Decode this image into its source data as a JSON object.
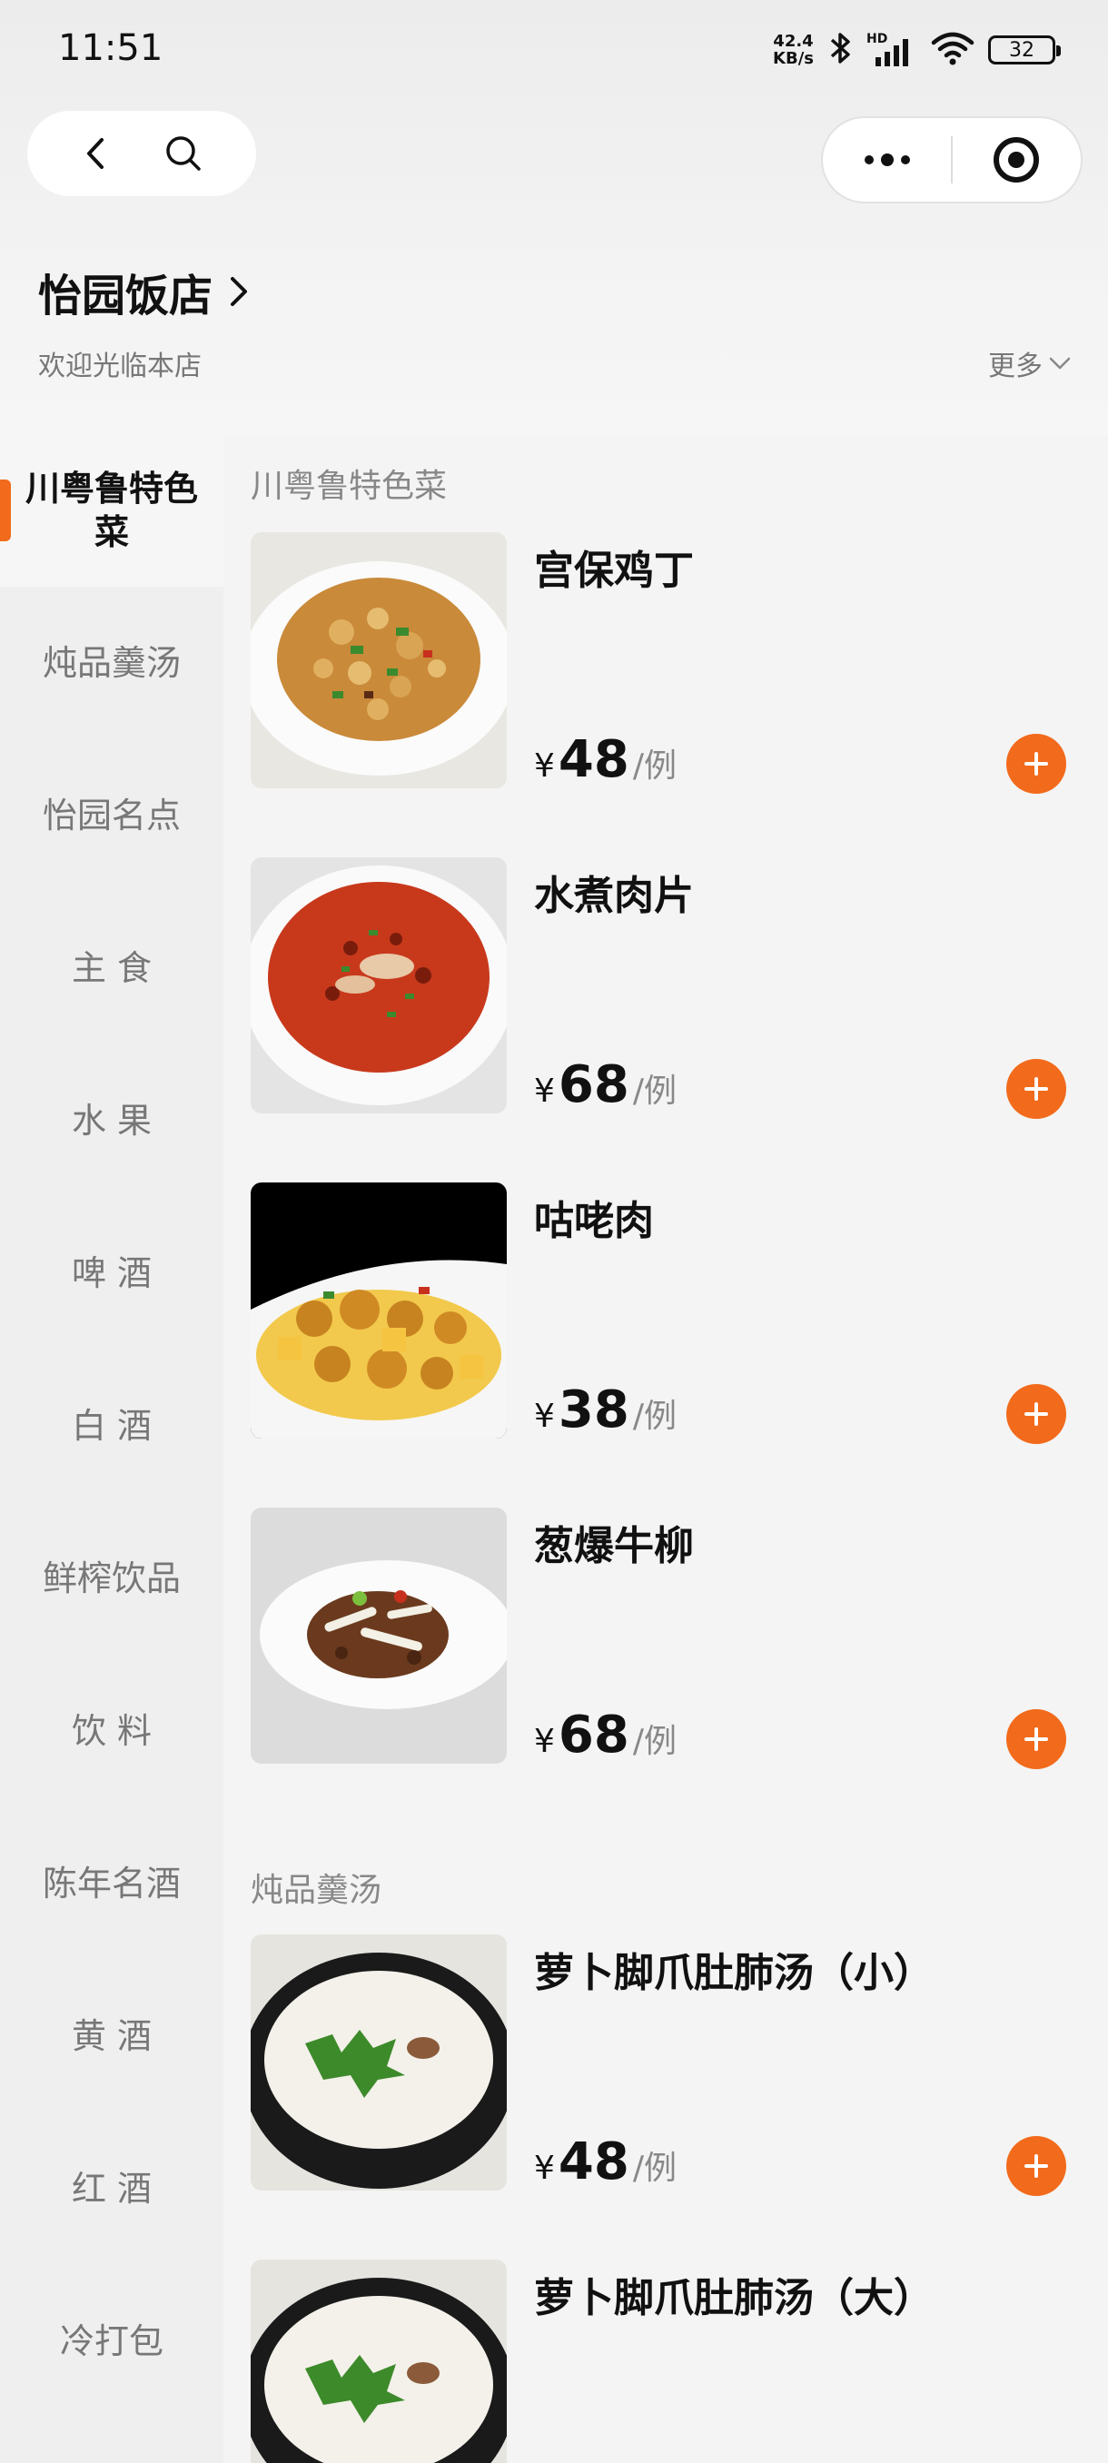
{
  "status_bar": {
    "time": "11:51",
    "net_speed_value": "42.4",
    "net_speed_unit": "KB/s",
    "hd_label": "HD",
    "battery_level": "32"
  },
  "store": {
    "name": "怡园饭店",
    "subtitle": "欢迎光临本店",
    "more_label": "更多"
  },
  "categories": [
    {
      "label": "川粤鲁特色菜",
      "active": true
    },
    {
      "label": "炖品羹汤"
    },
    {
      "label": "怡园名点"
    },
    {
      "label": "主 食"
    },
    {
      "label": "水 果"
    },
    {
      "label": "啤 酒"
    },
    {
      "label": "白 酒"
    },
    {
      "label": "鲜榨饮品"
    },
    {
      "label": "饮 料"
    },
    {
      "label": "陈年名酒"
    },
    {
      "label": "黄 酒"
    },
    {
      "label": "红 酒"
    },
    {
      "label": "冷打包"
    }
  ],
  "sections": [
    {
      "title": "川粤鲁特色菜",
      "dishes": [
        {
          "name": "宫保鸡丁",
          "currency": "¥",
          "price": "48",
          "unit": "/例"
        },
        {
          "name": "水煮肉片",
          "currency": "¥",
          "price": "68",
          "unit": "/例"
        },
        {
          "name": "咕咾肉",
          "currency": "¥",
          "price": "38",
          "unit": "/例"
        },
        {
          "name": "葱爆牛柳",
          "currency": "¥",
          "price": "68",
          "unit": "/例"
        }
      ]
    },
    {
      "title": "炖品羹汤",
      "dishes": [
        {
          "name": "萝卜脚爪肚肺汤（小）",
          "currency": "¥",
          "price": "48",
          "unit": "/例"
        },
        {
          "name": "萝卜脚爪肚肺汤（大）"
        }
      ]
    }
  ],
  "colors": {
    "accent": "#f26a1b"
  }
}
